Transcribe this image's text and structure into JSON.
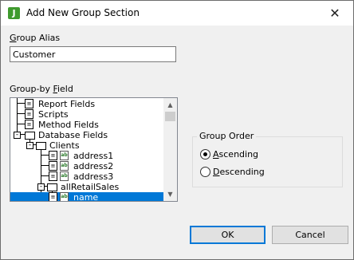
{
  "window": {
    "title": "Add New Group Section",
    "app_icon_letter": "J",
    "close_glyph": "✕"
  },
  "group_alias": {
    "label_underlined": "G",
    "label_rest": "roup Alias",
    "value": "Customer"
  },
  "group_by_field": {
    "label_pre": "Group-by ",
    "label_underlined": "F",
    "label_rest": "ield",
    "tree": [
      {
        "label": "Report Fields",
        "icon": "document-icon",
        "selected": false
      },
      {
        "label": "Scripts",
        "icon": "document-icon",
        "selected": false
      },
      {
        "label": "Method Fields",
        "icon": "document-icon",
        "selected": false
      },
      {
        "label": "Database Fields",
        "icon": "folder-icon",
        "selected": false
      },
      {
        "label": "Clients",
        "icon": "folder-icon",
        "selected": false
      },
      {
        "label": "address1",
        "icon": "field-icon",
        "selected": false
      },
      {
        "label": "address2",
        "icon": "field-icon",
        "selected": false
      },
      {
        "label": "address3",
        "icon": "field-icon",
        "selected": false
      },
      {
        "label": "allRetailSales",
        "icon": "folder-icon",
        "selected": false
      },
      {
        "label": "name",
        "icon": "field-icon",
        "selected": true
      }
    ]
  },
  "group_order": {
    "legend": "Group Order",
    "options": [
      {
        "underlined": "A",
        "rest": "scending",
        "checked": true
      },
      {
        "underlined": "D",
        "rest": "escending",
        "checked": false
      }
    ]
  },
  "buttons": {
    "ok": "OK",
    "cancel": "Cancel"
  },
  "colors": {
    "selection": "#0078d7",
    "app_icon": "#3f9a2e"
  }
}
